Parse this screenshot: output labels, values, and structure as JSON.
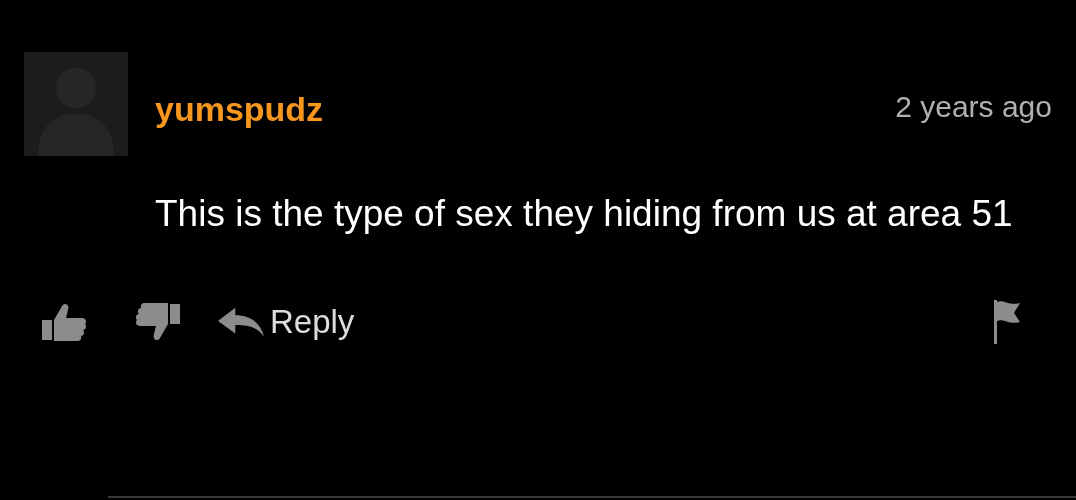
{
  "comment": {
    "username": "yumspudz",
    "time": "2 years ago",
    "text": "This is the type of sex they hiding from us at area 51"
  },
  "actions": {
    "reply": "Reply"
  }
}
